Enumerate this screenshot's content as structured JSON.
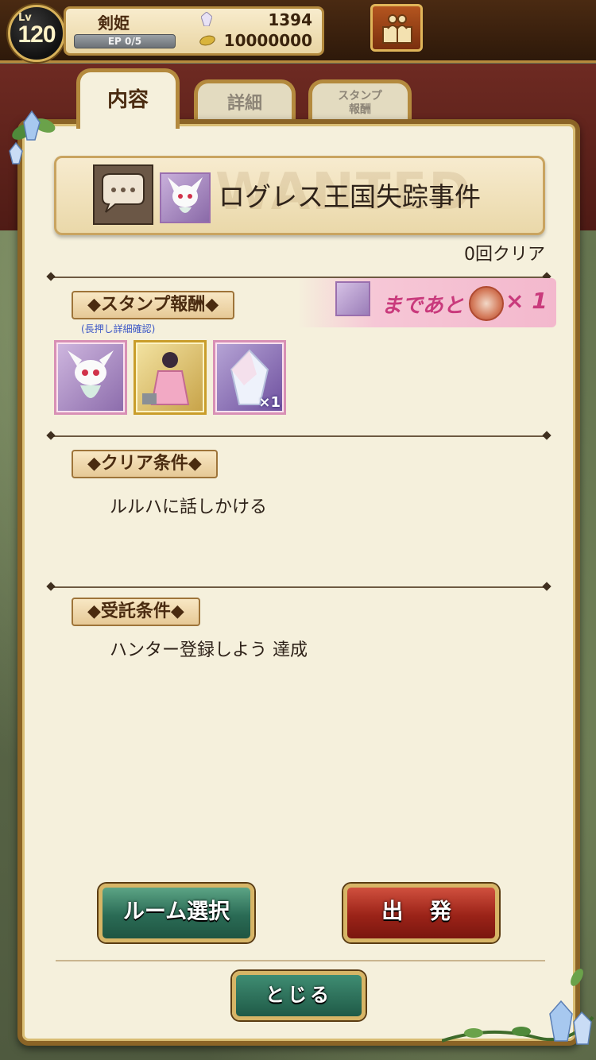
{
  "player": {
    "level_label": "Lv",
    "level": "120",
    "name": "剣姫",
    "ep": "EP  0/5",
    "stones": "1394",
    "coins": "10000000"
  },
  "tabs": {
    "content": "内容",
    "detail": "詳細",
    "stamp_line1": "スタンプ",
    "stamp_line2": "報酬"
  },
  "quest": {
    "watermark": "WANTED",
    "title": "ログレス王国失踪事件",
    "clear_count": "0回クリア"
  },
  "stamp_reward": {
    "section_label": "◆スタンプ報酬◆",
    "hint": "(長押し詳細確認)",
    "banner_text": "まであと",
    "banner_mult": "× 1",
    "item3_qty": "×1"
  },
  "clear_condition": {
    "section_label": "◆クリア条件◆",
    "text": "ルルハに話しかける"
  },
  "accept_condition": {
    "section_label": "◆受託条件◆",
    "text": "ハンター登録しよう 達成"
  },
  "buttons": {
    "room": "ルーム選択",
    "go": "出 発",
    "close": "とじる"
  },
  "colors": {
    "panel_bg": "#f5f0dc",
    "frame_gold": "#b48a3e",
    "stamp_pink": "#c93a7c",
    "go_red": "#9b2318",
    "room_green": "#2a6b55"
  }
}
